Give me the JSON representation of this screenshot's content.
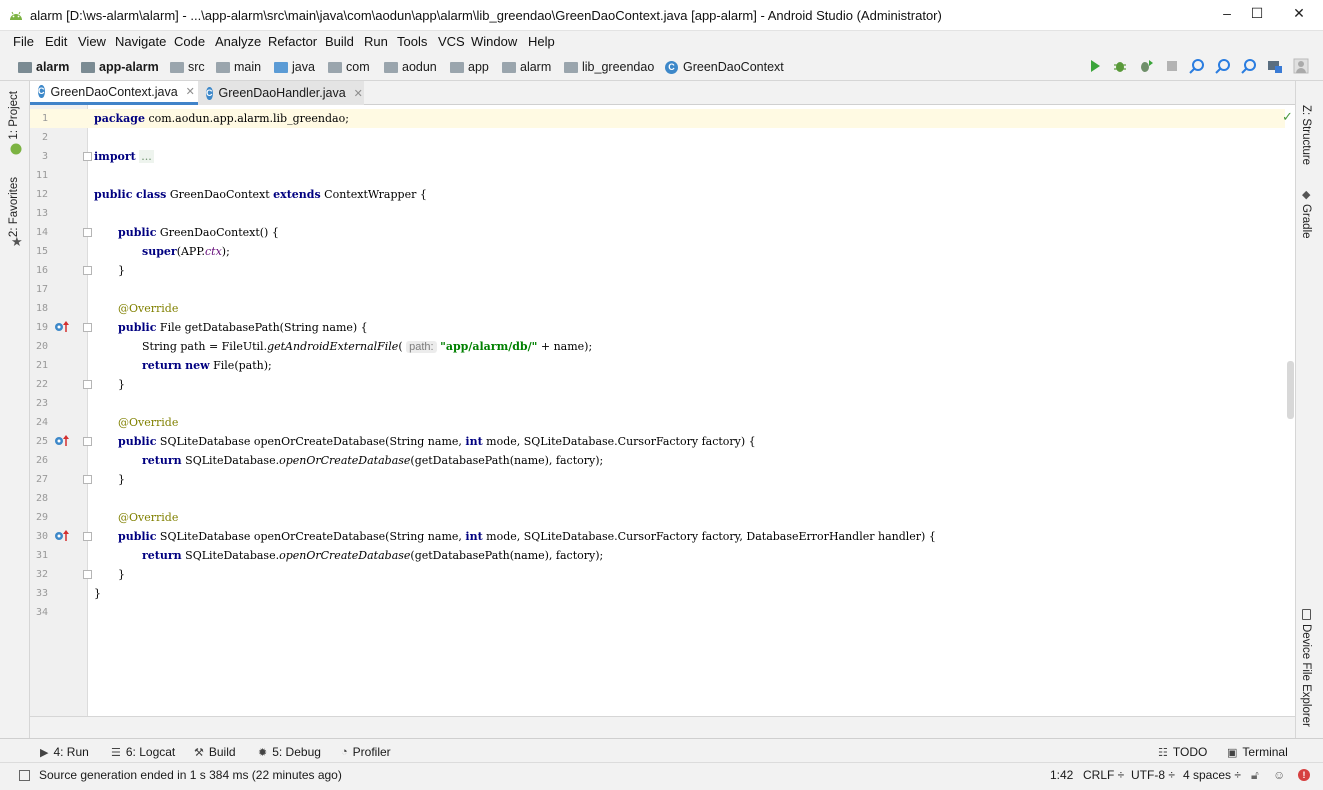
{
  "window": {
    "title": "alarm [D:\\ws-alarm\\alarm] - ...\\app-alarm\\src\\main\\java\\com\\aodun\\app\\alarm\\lib_greendao\\GreenDaoContext.java [app-alarm] - Android Studio (Administrator)",
    "minimize": "–",
    "maximize": "☐",
    "close": "✕"
  },
  "menu": [
    "File",
    "Edit",
    "View",
    "Navigate",
    "Code",
    "Analyze",
    "Refactor",
    "Build",
    "Run",
    "Tools",
    "VCS",
    "Window",
    "Help"
  ],
  "breadcrumb": [
    "alarm",
    "app-alarm",
    "src",
    "main",
    "java",
    "com",
    "aodun",
    "app",
    "alarm",
    "lib_greendao",
    "GreenDaoContext"
  ],
  "toolbar_icons": [
    "run-icon",
    "debug-icon",
    "attach-debugger-icon",
    "stop-icon",
    "search-icon",
    "find-icon",
    "find-usages-icon",
    "sdk-manager-icon",
    "profile-icon"
  ],
  "left_tabs": [
    "1: Project",
    "2: Favorites"
  ],
  "right_tabs": [
    "Z: Structure",
    "Gradle",
    "Device File Explorer"
  ],
  "editor_tabs": [
    {
      "label": "GreenDaoContext.java",
      "active": true
    },
    {
      "label": "GreenDaoHandler.java",
      "active": false
    }
  ],
  "code": {
    "line_numbers": [
      "1",
      "2",
      "3",
      "11",
      "12",
      "13",
      "14",
      "15",
      "16",
      "17",
      "18",
      "19",
      "20",
      "21",
      "22",
      "23",
      "24",
      "25",
      "26",
      "27",
      "28",
      "29",
      "30",
      "31",
      "32",
      "33",
      "34"
    ],
    "package_kw": "package",
    "package_name": " com.aodun.app.alarm.lib_greendao;",
    "import_kw": "import",
    "import_folded": "...",
    "public": "public",
    "class": "class",
    "extends": "extends",
    "class_name": " GreenDaoContext ",
    "parent": " ContextWrapper {",
    "ctor_name": " GreenDaoContext() {",
    "super_kw": "super",
    "super_open": "(APP.",
    "ctx_field": "ctx",
    "super_close": ");",
    "close_brace": "}",
    "override": "@Override",
    "m1_sig": " File getDatabasePath(String name) {",
    "m1_line1_a": "String path = FileUtil.",
    "m1_line1_method": "getAndroidExternalFile",
    "m1_line1_paren": "(",
    "param_hint": "path:",
    "m1_line1_str": "\"app/alarm/db/\"",
    "m1_line1_end": " + name);",
    "return_kw": "return",
    "new_kw": "new",
    "m1_line2_end": " File(path);",
    "m2_sig_a": " SQLiteDatabase openOrCreateDatabase(String name, ",
    "int_kw": "int",
    "m2_sig_b": " mode, SQLiteDatabase.CursorFactory factory) {",
    "m2_body_a": " SQLiteDatabase.",
    "m2_body_method": "openOrCreateDatabase",
    "m2_body_b": "(getDatabasePath(name), factory);",
    "m3_sig_b": " mode, SQLiteDatabase.CursorFactory factory, DatabaseErrorHandler handler) {"
  },
  "bottom_tools": [
    {
      "label": "4: Run",
      "icon": "run-icon"
    },
    {
      "label": "6: Logcat",
      "icon": "logcat-icon"
    },
    {
      "label": "Build",
      "icon": "build-icon"
    },
    {
      "label": "5: Debug",
      "icon": "debug-icon"
    },
    {
      "label": "Profiler",
      "icon": "profiler-icon"
    },
    {
      "label": "TODO",
      "icon": "todo-icon"
    },
    {
      "label": "Terminal",
      "icon": "terminal-icon"
    }
  ],
  "status": {
    "message": "Source generation ended in 1 s 384 ms (22 minutes ago)",
    "position": "1:42",
    "line_sep": "CRLF ÷",
    "encoding": "UTF-8 ÷",
    "indent": "4 spaces ÷"
  },
  "colors": {
    "keyword": "#000080",
    "annotation": "#808000",
    "string": "#008000",
    "field": "#660e7a",
    "active_tab_accent": "#4083c9",
    "current_line": "#fffae3"
  }
}
